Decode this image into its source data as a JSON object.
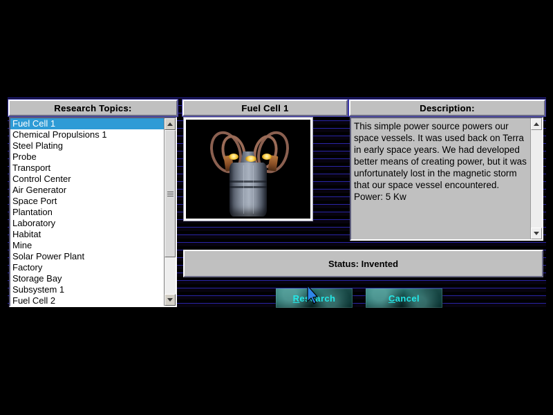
{
  "window": {
    "background_color": "#000000",
    "stripe_color": "#2a25a8"
  },
  "panels": {
    "topics_title": "Research Topics:",
    "item_title": "Fuel Cell 1",
    "description_title": "Description:"
  },
  "research_topics": {
    "selected_index": 0,
    "items": [
      "Fuel Cell 1",
      "Chemical Propulsions 1",
      "Steel Plating",
      "Probe",
      "Transport",
      "Control Center",
      "Air Generator",
      "Space Port",
      "Plantation",
      "Laboratory",
      "Habitat",
      "Mine",
      "Solar Power Plant",
      "Factory",
      "Storage Bay",
      "Subsystem 1",
      "Fuel Cell 2"
    ],
    "selection_bg": "#2e9bd6"
  },
  "preview": {
    "alt": "fuel-cell-render",
    "caption": "Fuel Cell 1"
  },
  "description": {
    "text": "This simple power source powers our space vessels.  It was used back on Terra in early space years. We had developed better means of creating power, but it was unfortunately lost in the magnetic storm that our space vessel encountered.  Power: 5 Kw"
  },
  "status": {
    "text": "Status: Invented"
  },
  "buttons": {
    "research": {
      "accel": "R",
      "rest": "esearch"
    },
    "cancel": {
      "accel": "C",
      "rest": "ancel"
    },
    "face_color": "#196360",
    "text_color": "#23e8e8"
  },
  "scrollbars": {
    "up_arrow": "arrow-up-icon",
    "down_arrow": "arrow-down-icon"
  }
}
